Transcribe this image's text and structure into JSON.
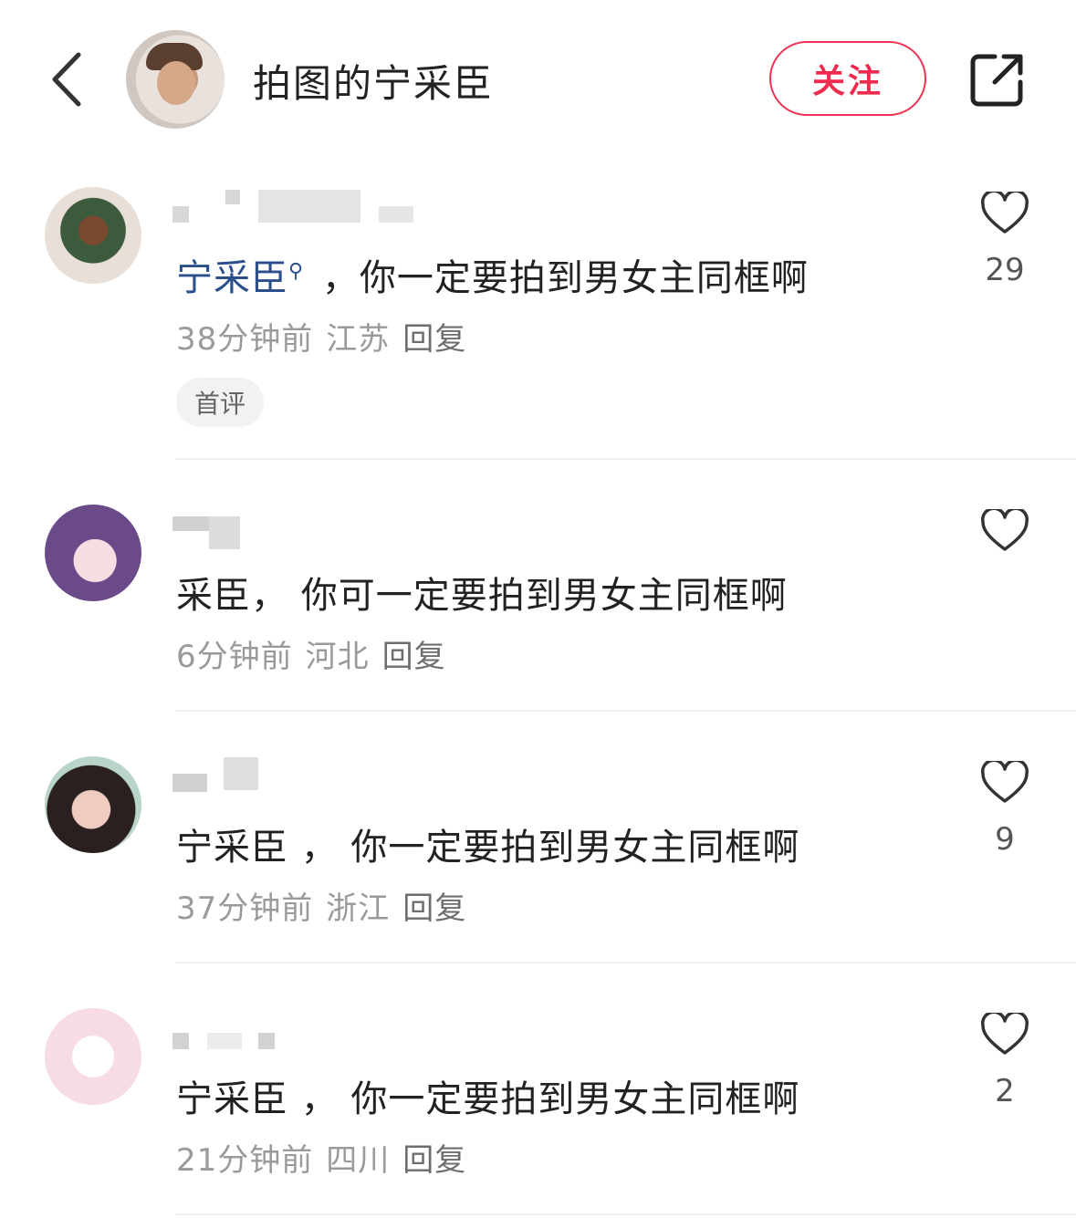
{
  "header": {
    "title": "拍图的宁采臣",
    "follow_label": "关注",
    "back_icon": "chevron-left-icon",
    "share_icon": "share-out-icon"
  },
  "comments": [
    {
      "mention": "宁采臣",
      "text": "，你一定要拍到男女主同框啊",
      "time": "38分钟前",
      "location": "江苏",
      "reply": "回复",
      "likes": "29",
      "tag": "首评"
    },
    {
      "text": "采臣， 你可一定要拍到男女主同框啊",
      "time": "6分钟前",
      "location": "河北",
      "reply": "回复",
      "likes": ""
    },
    {
      "text": "宁采臣 ， 你一定要拍到男女主同框啊",
      "time": "37分钟前",
      "location": "浙江",
      "reply": "回复",
      "likes": "9"
    },
    {
      "text": "宁采臣 ， 你一定要拍到男女主同框啊",
      "time": "21分钟前",
      "location": "四川",
      "reply": "回复",
      "likes": "2"
    }
  ],
  "colors": {
    "follow_accent": "#ee2a4e",
    "mention": "#2c4f8c"
  }
}
